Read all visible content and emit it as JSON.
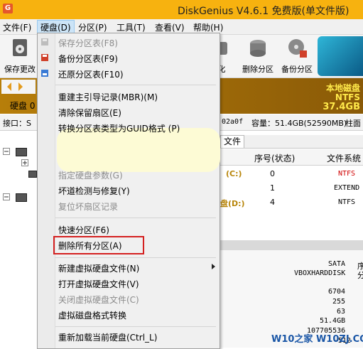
{
  "window": {
    "title": "DiskGenius V4.6.1 免费版(单文件版)",
    "app_icon": "G"
  },
  "menubar": {
    "items": [
      "文件(F)",
      "硬盘(D)",
      "分区(P)",
      "工具(T)",
      "查看(V)",
      "帮助(H)"
    ],
    "active": "硬盘(D)"
  },
  "toolbar": {
    "save_label": "保存更改",
    "partial_label": "化",
    "delete_partition": "删除分区",
    "backup_partition": "备份分区"
  },
  "banner": {
    "line1": "本地磁盘",
    "line2": "NTFS",
    "line3": "37.4GB"
  },
  "left_panel": {
    "disk_label": "硬盘 0",
    "port_label": "接口：S"
  },
  "infobar": {
    "id_fragment": "02a0f",
    "capacity": "容量：51.4GB(52590MB)",
    "cylinders": "柱面"
  },
  "tabs": {
    "file_tab": "文件"
  },
  "partition_table": {
    "headers": [
      "序号(状态)",
      "文件系统"
    ],
    "rows": [
      {
        "name": "(C:)",
        "index": "0",
        "fs": "NTFS"
      },
      {
        "name": "",
        "index": "1",
        "fs": "EXTEND"
      },
      {
        "name": "盘(D:)",
        "index": "4",
        "fs": "NTFS"
      }
    ]
  },
  "disk_details": {
    "bus": "SATA",
    "model": "VBOXHARDDISK",
    "side_1": "序",
    "side_2": "分",
    "numbers": [
      "6704",
      "255",
      "63",
      "51.4GB",
      "107705536",
      "-512"
    ]
  },
  "dropdown": {
    "items": [
      {
        "label": "保存分区表(F8)",
        "disabled": true,
        "icon": "save-icon"
      },
      {
        "label": "备份分区表(F9)",
        "disabled": false,
        "icon": "backup-icon"
      },
      {
        "label": "还原分区表(F10)",
        "disabled": false,
        "icon": "restore-icon"
      },
      {
        "label": "重建主引导记录(MBR)(M)",
        "disabled": false
      },
      {
        "label": "清除保留扇区(E)",
        "disabled": false
      },
      {
        "label": "转换分区表类型为GUID格式 (P)",
        "disabled": false
      },
      {
        "label": "指定硬盘参数(G)",
        "disabled": true
      },
      {
        "label": "坏道检测与修复(Y)",
        "disabled": false
      },
      {
        "label": "复位坏扇区记录",
        "disabled": true
      },
      {
        "label": "快速分区(F6)",
        "disabled": false
      },
      {
        "label": "删除所有分区(A)",
        "disabled": false
      },
      {
        "label": "新建虚拟硬盘文件(N)",
        "disabled": false
      },
      {
        "label": "打开虚拟硬盘文件(V)",
        "disabled": false
      },
      {
        "label": "关闭虚拟硬盘文件(C)",
        "disabled": true
      },
      {
        "label": "虚拟磁盘格式转换",
        "disabled": false
      },
      {
        "label": "重新加载当前硬盘(Ctrl_L)",
        "disabled": false
      }
    ]
  },
  "watermark": "W10之家 W10ZJ.COM",
  "colors": {
    "titlebar": "#f7b20f",
    "banner_text": "#ffe94a",
    "highlight": "#d42020",
    "fs_red": "#d00000"
  }
}
